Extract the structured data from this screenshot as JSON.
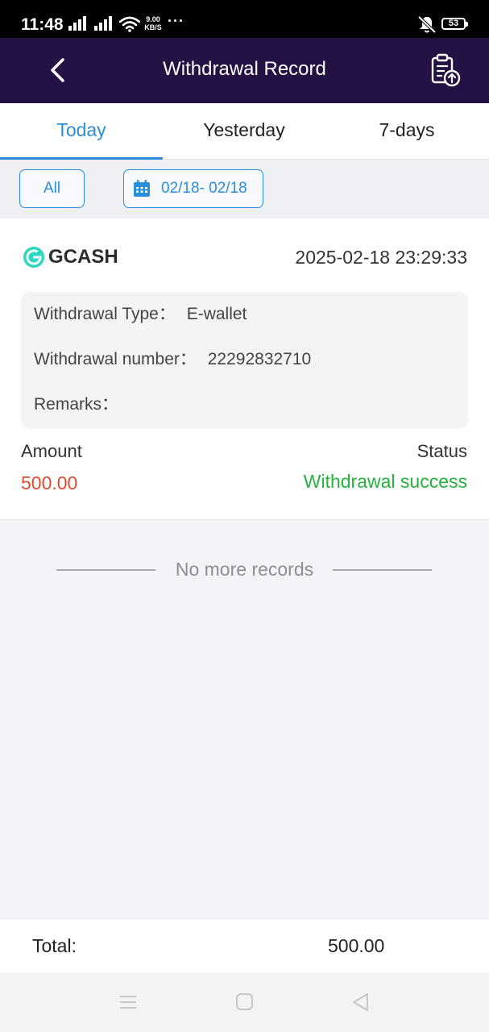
{
  "status_bar": {
    "time": "11:48",
    "net_speed_value": "9.00",
    "net_speed_unit": "KB/S",
    "dots": "···",
    "battery": "53"
  },
  "header": {
    "title": "Withdrawal Record",
    "background": "#231243"
  },
  "tabs": [
    {
      "label": "Today",
      "active": true
    },
    {
      "label": "Yesterday",
      "active": false
    },
    {
      "label": "7-days",
      "active": false
    }
  ],
  "filters": {
    "all_label": "All",
    "date_range": "02/18- 02/18"
  },
  "record": {
    "provider": "GCASH",
    "datetime": "2025-02-18 23:29:33",
    "withdrawal_type_label": "Withdrawal Type：",
    "withdrawal_type_value": "E-wallet",
    "withdrawal_number_label": "Withdrawal number：",
    "withdrawal_number_value": "22292832710",
    "remarks_label": "Remarks：",
    "remarks_value": "",
    "amount_label": "Amount",
    "amount_value": "500.00",
    "status_label": "Status",
    "status_value": "Withdrawal success"
  },
  "list_end_text": "No more records",
  "total": {
    "label": "Total:",
    "value": "500.00"
  },
  "colors": {
    "accent": "#2a8ed8",
    "amount": "#e04a2f",
    "success": "#25b33d"
  }
}
